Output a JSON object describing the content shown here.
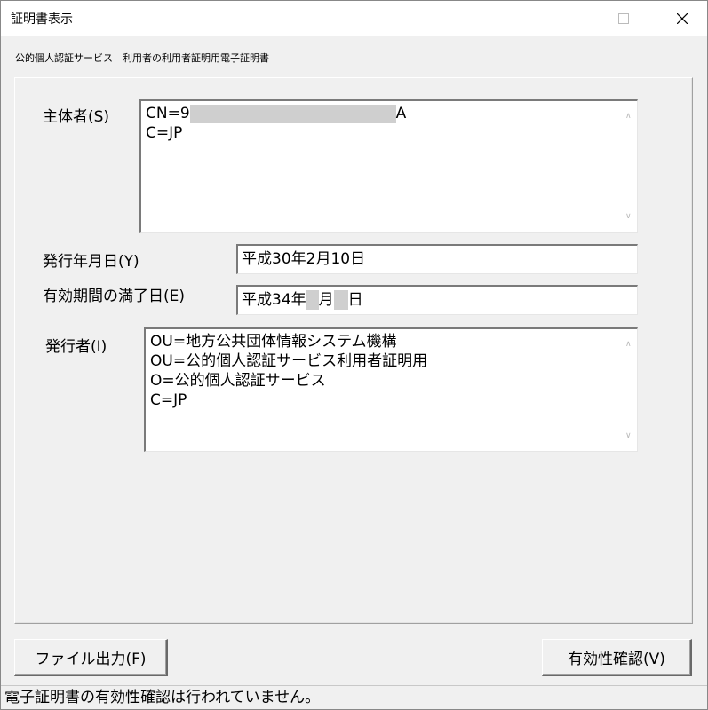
{
  "window": {
    "title": "証明書表示"
  },
  "subtitle": "公的個人認証サービス　利用者の利用者証明用電子証明書",
  "subject": {
    "label": "主体者(S)",
    "line1_prefix": "CN=9",
    "line1_suffix": "A",
    "line2": "C=JP"
  },
  "issue_date": {
    "label": "発行年月日(Y)",
    "value": "平成30年2月10日"
  },
  "expiry_date": {
    "label": "有効期間の満了日(E)",
    "part1": "平成34年",
    "part2": "月",
    "part3": "日"
  },
  "issuer": {
    "label": "発行者(I)",
    "lines": [
      "OU=地方公共団体情報システム機構",
      "OU=公的個人認証サービス利用者証明用",
      "O=公的個人認証サービス",
      "C=JP"
    ]
  },
  "buttons": {
    "export": "ファイル出力(F)",
    "verify": "有効性確認(V)"
  },
  "status": "電子証明書の有効性確認は行われていません。"
}
